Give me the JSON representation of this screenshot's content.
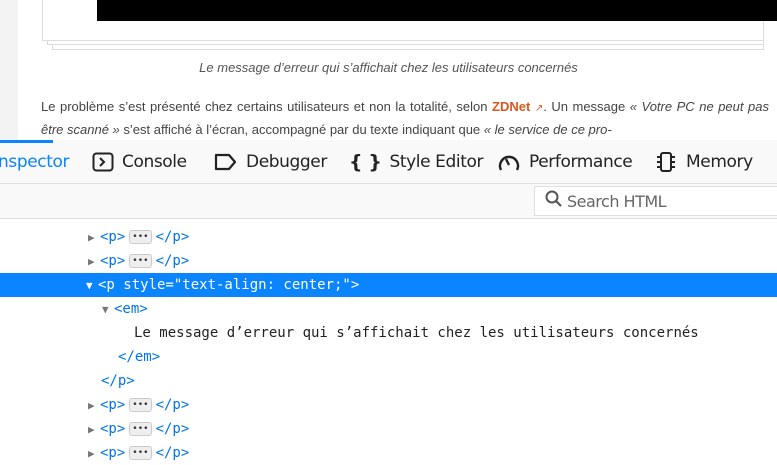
{
  "page": {
    "caption": "Le message d’erreur qui s’affichait chez les utilisateurs concernés",
    "para_1": "Le problème s’est présenté chez certains utilisateurs et non la totalité, selon ",
    "link": "ZDNet",
    "para_2": ". Un message ",
    "quote_1": "« Votre PC ne peut pas être scanné »",
    "para_3": " s’est affiché à l’écran, accompagné par du texte indiquant que ",
    "quote_2": "« le service de ce pro-"
  },
  "devtools": {
    "tabs": [
      {
        "label": "nspector",
        "icon": "inspector-icon"
      },
      {
        "label": "Console",
        "icon": "console-icon"
      },
      {
        "label": "Debugger",
        "icon": "debugger-icon"
      },
      {
        "label": "Style Editor",
        "icon": "style-editor-icon"
      },
      {
        "label": "Performance",
        "icon": "performance-icon"
      },
      {
        "label": "Memory",
        "icon": "memory-icon"
      }
    ],
    "search_placeholder": "Search HTML",
    "tree": {
      "p_collapsed_open": "<p>",
      "p_collapsed_close": "</p>",
      "selected_open": "<p style=\"text-align: center;\">",
      "em_open": "<em>",
      "em_text": "Le message d’erreur qui s’affichait chez les utilisateurs concernés",
      "em_close": "</em>",
      "p_close": "</p>"
    }
  }
}
